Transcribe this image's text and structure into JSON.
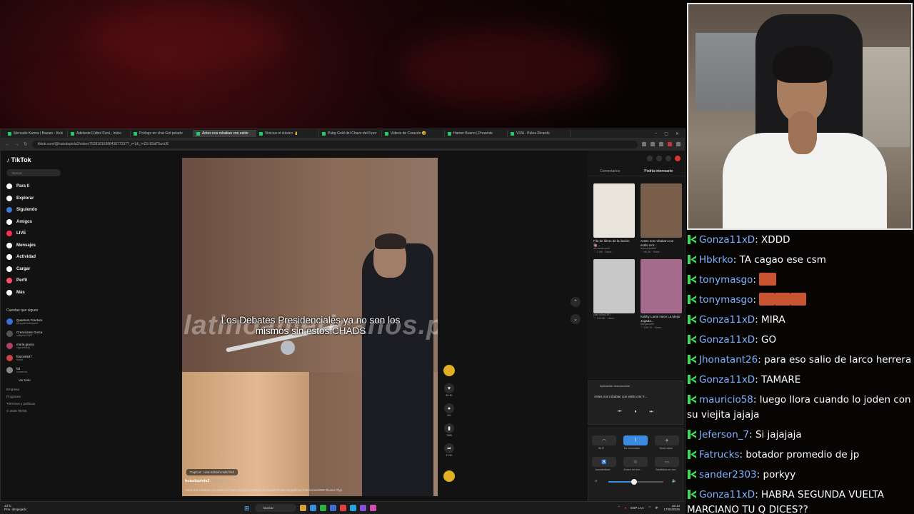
{
  "browser": {
    "tabs": [
      {
        "label": "Mercado Karma | Bazam - Kick",
        "active": false
      },
      {
        "label": "Adelante Fútbol Perú - Inicio",
        "active": false
      },
      {
        "label": "Prólogo en chat Gol pelado",
        "active": false
      },
      {
        "label": "Antes nos robaban con estilo",
        "active": true
      },
      {
        "label": "Vinicius el clásico 👌",
        "active": false
      },
      {
        "label": "Pubg Gold del Chavo del 8 por",
        "active": false
      },
      {
        "label": "Videos de Corazón 😆",
        "active": false
      },
      {
        "label": "Hamer Bueno | Presente",
        "active": false
      },
      {
        "label": "VIVA - Pelea Ricardo",
        "active": false
      }
    ],
    "url": "tiktok.com/@hutodopiola2/video/7528181698843077237?_r=1&_t=ZS-8SdT5uvUE",
    "window_controls": [
      "–",
      "▢",
      "✕"
    ]
  },
  "tiktok": {
    "logo": "TikTok",
    "search_placeholder": "Buscar",
    "menu": [
      {
        "label": "Para ti",
        "icon": "home-icon",
        "color": "#ffffff"
      },
      {
        "label": "Explorar",
        "icon": "compass-icon",
        "color": "#ffffff"
      },
      {
        "label": "Siguiendo",
        "icon": "following-icon",
        "color": "#3a7bd5"
      },
      {
        "label": "Amigos",
        "icon": "friends-icon",
        "color": "#ffffff"
      },
      {
        "label": "LIVE",
        "icon": "live-icon",
        "color": "#ff2d55"
      },
      {
        "label": "Mensajes",
        "icon": "messages-icon",
        "color": "#ffffff"
      },
      {
        "label": "Actividad",
        "icon": "activity-icon",
        "color": "#ffffff"
      },
      {
        "label": "Cargar",
        "icon": "upload-icon",
        "color": "#ffffff"
      },
      {
        "label": "Perfil",
        "icon": "profile-icon",
        "color": "#ff4d6a"
      },
      {
        "label": "Más",
        "icon": "more-icon",
        "color": "#ffffff"
      }
    ],
    "following_title": "Cuentas que sigues",
    "accounts": [
      {
        "name": "Quantum Fracture",
        "handle": "thequantumfracture"
      },
      {
        "name": "Creaciones Gorca",
        "handle": "xdsgohs.0429"
      },
      {
        "name": "maria gracia",
        "handle": "mgcomfaldy"
      },
      {
        "name": "fdulos6547",
        "handle": "fdulos"
      },
      {
        "name": "faf",
        "handle": "comemos"
      }
    ],
    "see_all": "Ver todo",
    "footer": [
      "Empresa",
      "Programa",
      "Términos y políticas",
      "© 2026 TikTok"
    ],
    "video": {
      "watermark": "latinoamericanos.pe",
      "caption": "Los Debates Presidenciales ya no son los mismos sin estos CHADS",
      "capcut_label": "CapCut · Una edición más fácil",
      "author": "hutodopiola2",
      "posted": "· Hace 2 días",
      "description": "Antes nos robaban con estilo cmr #peru #fujimori #elangenta #toledo #mariovargasllosa #elecciones2026 #humor #fyp"
    },
    "actions": [
      {
        "icon": "heart-icon",
        "glyph": "♥",
        "count": "86.3K"
      },
      {
        "icon": "comment-icon",
        "glyph": "●",
        "count": "391"
      },
      {
        "icon": "bookmark-icon",
        "glyph": "▮",
        "count": "7685"
      },
      {
        "icon": "share-icon",
        "glyph": "➦",
        "count": "13.4K"
      }
    ],
    "right_tabs": [
      "Comentarios",
      "Podría interesarte"
    ],
    "suggestions": [
      {
        "title": "Fila de libros de la ilusión 📚...",
        "author": "armando.polil",
        "meta": "♡ 1.5M · Hace...",
        "color": "#e8e4dc"
      },
      {
        "title": "Antes nos robaban con estilo cmr...",
        "author": "hutodopiola2",
        "meta": "♡ 86.3K · Hace...",
        "color": "#7a5e4c"
      },
      {
        "title": "",
        "author": "juan.silva1391",
        "meta": "♡ 144.6K · Hace...",
        "color": "#c8c8c8"
      },
      {
        "title": "Kabhy Lame Hace La Mejor Jugada...",
        "author": "danganseb",
        "meta": "♡ 199.7K · Hace...",
        "color": "#a66a8c"
      }
    ]
  },
  "quick_settings": {
    "media_source": "Aplicación desconocida",
    "media_title": "Antes nos robaban con estilo cmr #...",
    "tiles": [
      {
        "label": "Wi-Fi",
        "glyph": "◠",
        "on": false
      },
      {
        "label": "No conectado",
        "glyph": "ᛒ",
        "on": true
      },
      {
        "label": "Modo avión",
        "glyph": "✈",
        "on": false
      }
    ],
    "tiles2": [
      {
        "label": "Accesibilidad",
        "glyph": "♿",
        "on": false
      },
      {
        "label": "Ahorro de ene...",
        "glyph": "♲",
        "on": false
      },
      {
        "label": "Subtítulos en vivo",
        "glyph": "▭",
        "on": false
      }
    ],
    "volume": 0.48
  },
  "taskbar": {
    "temp": "23°C",
    "weather": "Prin. despejado",
    "search": "Buscar",
    "lang": "ESP LAA",
    "time": "15:14",
    "date": "17/04/2026"
  },
  "chat": [
    {
      "user": "Gonza11xD",
      "color": "#7fb2ff",
      "text": "XDDD"
    },
    {
      "user": "Hbkrko",
      "color": "#7fb2ff",
      "text": "TA cagao ese csm"
    },
    {
      "user": "tonymasgo",
      "color": "#7fb2ff",
      "text": "",
      "emotes": [
        24
      ]
    },
    {
      "user": "tonymasgo",
      "color": "#7fb2ff",
      "text": "",
      "emotes": [
        22,
        22,
        22
      ]
    },
    {
      "user": "Gonza11xD",
      "color": "#7fb2ff",
      "text": "MIRA"
    },
    {
      "user": "Gonza11xD",
      "color": "#7fb2ff",
      "text": "GO"
    },
    {
      "user": "Jhonatant26",
      "color": "#7fb2ff",
      "text": "para eso salio de larco herrera"
    },
    {
      "user": "Gonza11xD",
      "color": "#7fb2ff",
      "text": "TAMARE"
    },
    {
      "user": "mauricio58",
      "color": "#7fb2ff",
      "text": "luego llora cuando lo joden con su viejita jajaja",
      "wrap": true
    },
    {
      "user": "Jeferson_7",
      "color": "#7fb2ff",
      "text": "Si jajajaja"
    },
    {
      "user": "Fatrucks",
      "color": "#7fb2ff",
      "text": "botador promedio de jp"
    },
    {
      "user": "sander2303",
      "color": "#7fb2ff",
      "text": "porkyy"
    },
    {
      "user": "Gonza11xD",
      "color": "#7fb2ff",
      "text": "HABRA SEGUNDA VUELTA MARCIANO TU Q DICES??",
      "wrap": true
    }
  ]
}
